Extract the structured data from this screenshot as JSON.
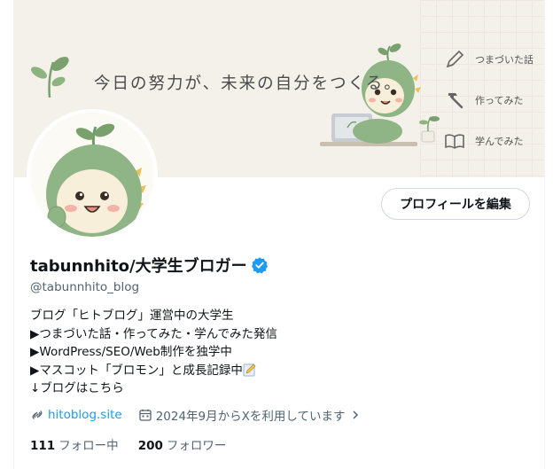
{
  "banner": {
    "tagline": "今日の努力が、未来の自分をつくる。",
    "menu": [
      {
        "label": "つまづいた話",
        "icon": "pencil-icon"
      },
      {
        "label": "作ってみた",
        "icon": "hammer-icon"
      },
      {
        "label": "学んでみた",
        "icon": "book-icon"
      }
    ]
  },
  "profile": {
    "edit_button": "プロフィールを編集",
    "display_name": "tabunnhito/大学生ブロガー",
    "handle": "@tabunnhito_blog",
    "bio": [
      "ブログ「ヒトブログ」運営中の大学生",
      "▶つまづいた話・作ってみた・学んでみた発信",
      "▶WordPress/SEO/Web制作を独学中",
      "▶マスコット「ブロモン」と成長記録中",
      "↓ブログはこちら"
    ],
    "website": "hitoblog.site",
    "joined": "2024年9月からXを利用しています",
    "following_count": "111",
    "following_label": "フォロー中",
    "followers_count": "200",
    "followers_label": "フォロワー"
  },
  "colors": {
    "accent": "#1d9bf0",
    "banner_bg": "#f4f1ea",
    "mascot_green": "#6e9e6e"
  }
}
